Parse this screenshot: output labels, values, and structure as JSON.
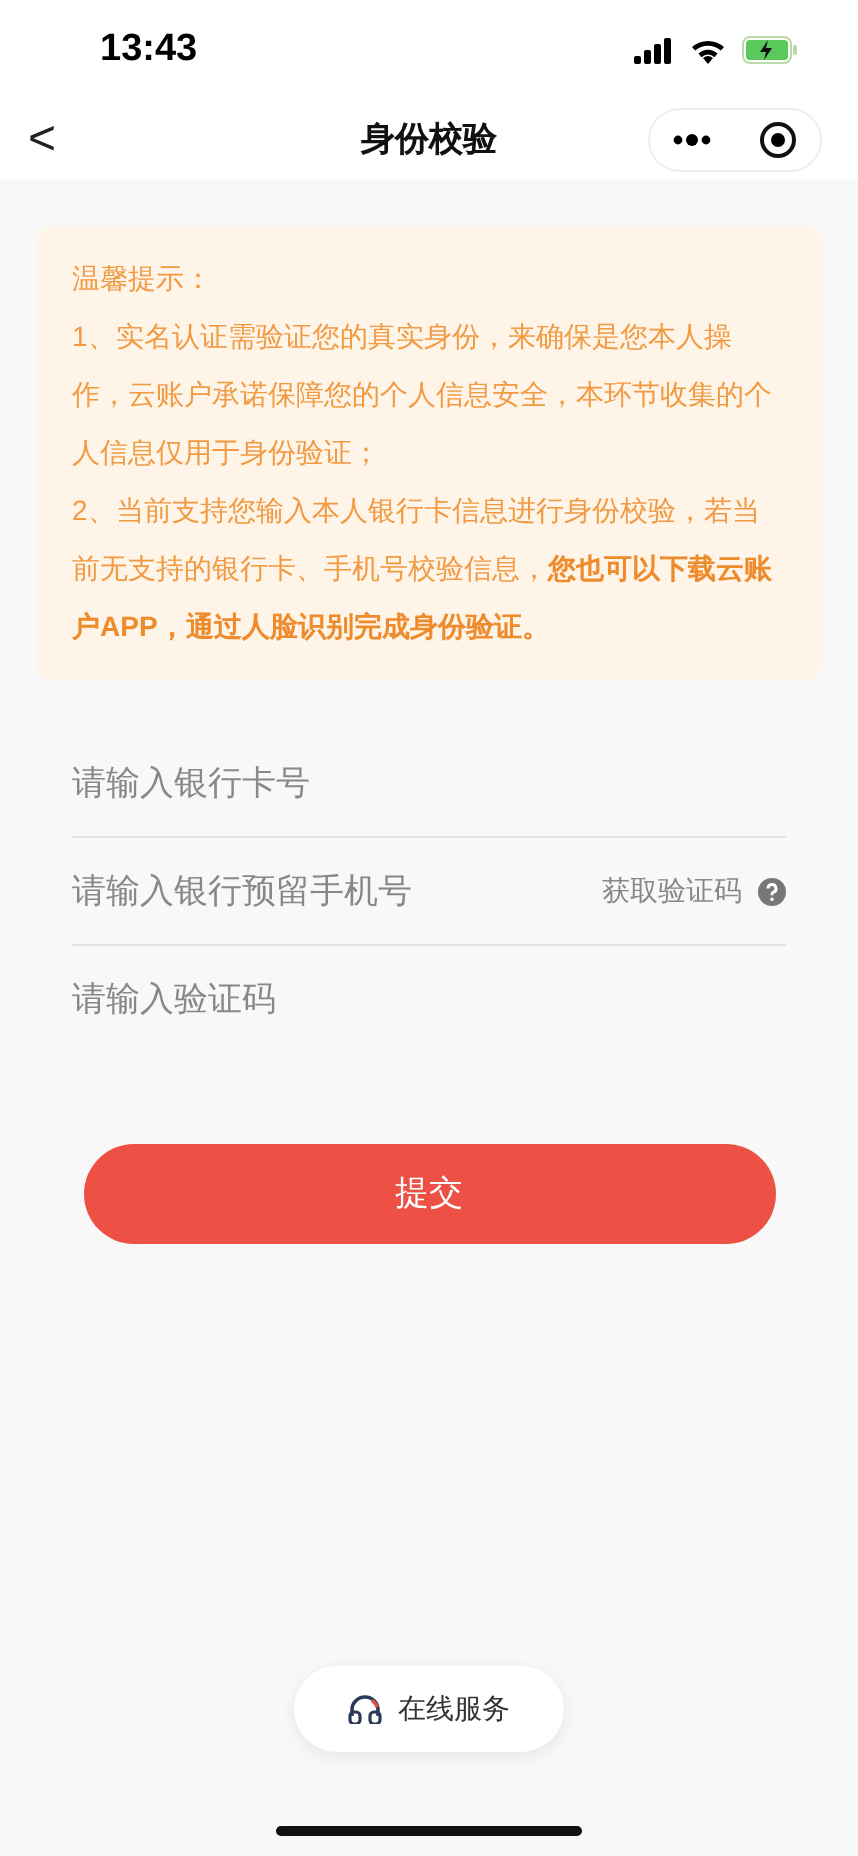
{
  "status_bar": {
    "time": "13:43"
  },
  "nav": {
    "back": "<",
    "title": "身份校验"
  },
  "notice": {
    "heading": "温馨提示：",
    "items": [
      "1、实名认证需验证您的真实身份，来确保是您本人操作，云账户承诺保障您的个人信息安全，本环节收集的个人信息仅用于身份验证；",
      "2、当前支持您输入本人银行卡信息进行身份校验，若当前无支持的银行卡、手机号校验信息，**您也可以下载云账户APP，通过人脸识别完成身份验证。**"
    ]
  },
  "fields": [
    {
      "placeholder": "请输入银行卡号"
    },
    {
      "placeholder": "请输入银行预留手机号",
      "action": "获取验证码"
    },
    {
      "placeholder": "请输入验证码"
    }
  ],
  "submit": "提交",
  "service": "在线服务"
}
